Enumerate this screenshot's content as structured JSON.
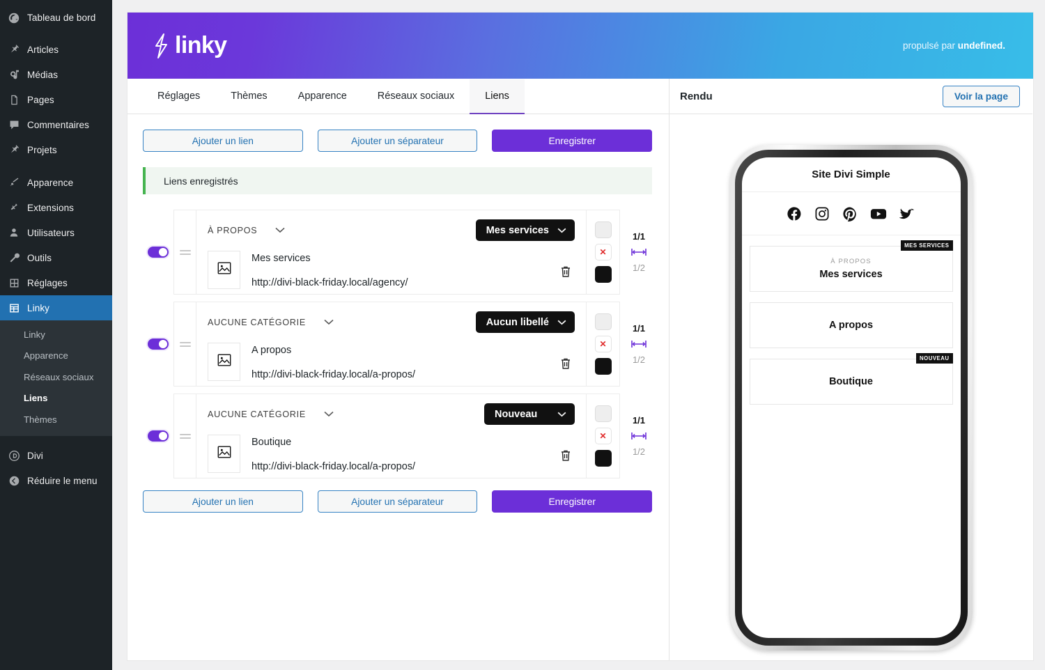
{
  "wp_sidebar": {
    "items": [
      {
        "label": "Tableau de bord",
        "icon": "dashboard-icon"
      },
      {
        "label": "Articles",
        "icon": "pin-icon"
      },
      {
        "label": "Médias",
        "icon": "media-icon"
      },
      {
        "label": "Pages",
        "icon": "pages-icon"
      },
      {
        "label": "Commentaires",
        "icon": "comment-icon"
      },
      {
        "label": "Projets",
        "icon": "pin-icon"
      },
      {
        "label": "Apparence",
        "icon": "brush-icon"
      },
      {
        "label": "Extensions",
        "icon": "plug-icon"
      },
      {
        "label": "Utilisateurs",
        "icon": "user-icon"
      },
      {
        "label": "Outils",
        "icon": "wrench-icon"
      },
      {
        "label": "Réglages",
        "icon": "settings-icon"
      },
      {
        "label": "Linky",
        "icon": "grid-icon"
      }
    ],
    "submenu": [
      {
        "label": "Linky"
      },
      {
        "label": "Apparence"
      },
      {
        "label": "Réseaux sociaux"
      },
      {
        "label": "Liens"
      },
      {
        "label": "Thèmes"
      }
    ],
    "submenu_current": "Liens",
    "active_item": "Linky",
    "footer": [
      {
        "label": "Divi",
        "icon": "divi-icon"
      },
      {
        "label": "Réduire le menu",
        "icon": "collapse-icon"
      }
    ],
    "colors": {
      "bg": "#1d2327",
      "submenu_bg": "#2c3338",
      "active": "#2271b1"
    }
  },
  "banner": {
    "logo_text": "linky",
    "logo_icon": "bolt-icon",
    "powered_prefix": "propulsé par ",
    "powered_strong": "undefined."
  },
  "tabs": [
    {
      "label": "Réglages",
      "selected": false
    },
    {
      "label": "Thèmes",
      "selected": false
    },
    {
      "label": "Apparence",
      "selected": false
    },
    {
      "label": "Réseaux sociaux",
      "selected": false
    },
    {
      "label": "Liens",
      "selected": true
    }
  ],
  "toolbar": {
    "add_link": "Ajouter un lien",
    "add_separator": "Ajouter un séparateur",
    "save": "Enregistrer"
  },
  "notice": {
    "text": "Liens enregistrés",
    "accent": "#46b450"
  },
  "rows": [
    {
      "enabled": true,
      "category": "À PROPOS",
      "label_select": "Mes services",
      "title": "Mes services",
      "url": "http://divi-black-friday.local/agency/",
      "thumb_icon": "image-placeholder-icon",
      "delete_icon": "trash-icon",
      "swatches": [
        "empty",
        "none",
        "black"
      ],
      "frac_top": "1/1",
      "frac_bottom": "1/2",
      "width_icon": "full-width-icon"
    },
    {
      "enabled": true,
      "category": "AUCUNE CATÉGORIE",
      "label_select": "Aucun libellé",
      "title": "A propos",
      "url": "http://divi-black-friday.local/a-propos/",
      "thumb_icon": "image-placeholder-icon",
      "delete_icon": "trash-icon",
      "swatches": [
        "empty",
        "none",
        "black"
      ],
      "frac_top": "1/1",
      "frac_bottom": "1/2",
      "width_icon": "full-width-icon"
    },
    {
      "enabled": true,
      "category": "AUCUNE CATÉGORIE",
      "label_select": "Nouveau",
      "title": "Boutique",
      "url": "http://divi-black-friday.local/a-propos/",
      "thumb_icon": "image-placeholder-icon",
      "delete_icon": "trash-icon",
      "swatches": [
        "empty",
        "none",
        "black"
      ],
      "frac_top": "1/1",
      "frac_bottom": "1/2",
      "width_icon": "full-width-icon"
    }
  ],
  "preview": {
    "header_title": "Rendu",
    "view_page_button": "Voir la page",
    "site_title": "Site Divi Simple",
    "socials": [
      {
        "name": "facebook-icon"
      },
      {
        "name": "instagram-icon"
      },
      {
        "name": "pinterest-icon"
      },
      {
        "name": "youtube-icon"
      },
      {
        "name": "twitter-icon"
      }
    ],
    "cards": [
      {
        "badge": "MES SERVICES",
        "sub": "À PROPOS",
        "title": "Mes services"
      },
      {
        "badge": "",
        "sub": "",
        "title": "A propos"
      },
      {
        "badge": "NOUVEAU",
        "sub": "",
        "title": "Boutique"
      }
    ]
  },
  "colors": {
    "brand_purple": "#6c2fd8",
    "wp_blue": "#2271b1",
    "notice_green": "#46b450",
    "black": "#111111"
  }
}
